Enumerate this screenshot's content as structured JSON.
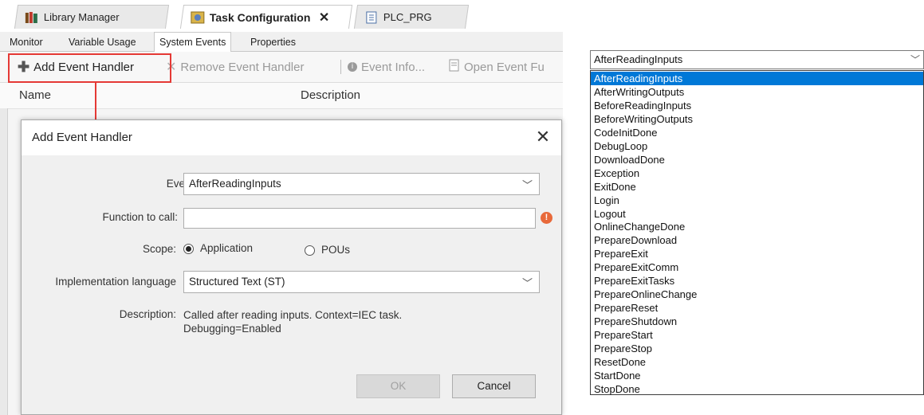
{
  "tabs": [
    {
      "label": "Library Manager",
      "icon": "library-icon"
    },
    {
      "label": "Task Configuration",
      "icon": "task-config-icon",
      "close": "✕"
    },
    {
      "label": "PLC_PRG",
      "icon": "document-icon"
    }
  ],
  "sub_tabs": [
    "Monitor",
    "Variable Usage",
    "System Events",
    "Properties"
  ],
  "toolbar": {
    "add": "Add Event Handler",
    "remove": "Remove Event Handler",
    "info": "Event Info...",
    "open": "Open Event Fu"
  },
  "columns": {
    "name": "Name",
    "description": "Description"
  },
  "dialog": {
    "title": "Add Event Handler",
    "event_label": "Event:",
    "event_value": "AfterReadingInputs",
    "function_label": "Function to call:",
    "function_value": "",
    "scope_label": "Scope:",
    "scope_application": "Application",
    "scope_pous": "POUs",
    "impl_label": "Implementation language",
    "impl_value": "Structured Text (ST)",
    "desc_label": "Description:",
    "desc_line1": "Called after reading inputs. Context=IEC task.",
    "desc_line2": "Debugging=Enabled",
    "ok": "OK",
    "cancel": "Cancel"
  },
  "dropdown": {
    "selected": "AfterReadingInputs",
    "items": [
      "AfterReadingInputs",
      "AfterWritingOutputs",
      "BeforeReadingInputs",
      "BeforeWritingOutputs",
      "CodeInitDone",
      "DebugLoop",
      "DownloadDone",
      "Exception",
      "ExitDone",
      "Login",
      "Logout",
      "OnlineChangeDone",
      "PrepareDownload",
      "PrepareExit",
      "PrepareExitComm",
      "PrepareExitTasks",
      "PrepareOnlineChange",
      "PrepareReset",
      "PrepareShutdown",
      "PrepareStart",
      "PrepareStop",
      "ResetDone",
      "StartDone",
      "StopDone"
    ]
  },
  "colors": {
    "highlight": "#0078d7",
    "annotation": "#e53935",
    "warning": "#e8693a"
  }
}
